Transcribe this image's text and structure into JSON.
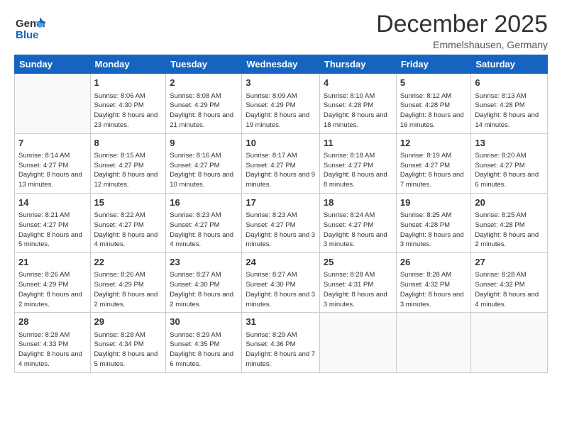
{
  "header": {
    "logo_general": "General",
    "logo_blue": "Blue",
    "month_title": "December 2025",
    "location": "Emmelshausen, Germany"
  },
  "weekdays": [
    "Sunday",
    "Monday",
    "Tuesday",
    "Wednesday",
    "Thursday",
    "Friday",
    "Saturday"
  ],
  "weeks": [
    [
      {
        "day": "",
        "sunrise": "",
        "sunset": "",
        "daylight": ""
      },
      {
        "day": "1",
        "sunrise": "Sunrise: 8:06 AM",
        "sunset": "Sunset: 4:30 PM",
        "daylight": "Daylight: 8 hours and 23 minutes."
      },
      {
        "day": "2",
        "sunrise": "Sunrise: 8:08 AM",
        "sunset": "Sunset: 4:29 PM",
        "daylight": "Daylight: 8 hours and 21 minutes."
      },
      {
        "day": "3",
        "sunrise": "Sunrise: 8:09 AM",
        "sunset": "Sunset: 4:29 PM",
        "daylight": "Daylight: 8 hours and 19 minutes."
      },
      {
        "day": "4",
        "sunrise": "Sunrise: 8:10 AM",
        "sunset": "Sunset: 4:28 PM",
        "daylight": "Daylight: 8 hours and 18 minutes."
      },
      {
        "day": "5",
        "sunrise": "Sunrise: 8:12 AM",
        "sunset": "Sunset: 4:28 PM",
        "daylight": "Daylight: 8 hours and 16 minutes."
      },
      {
        "day": "6",
        "sunrise": "Sunrise: 8:13 AM",
        "sunset": "Sunset: 4:28 PM",
        "daylight": "Daylight: 8 hours and 14 minutes."
      }
    ],
    [
      {
        "day": "7",
        "sunrise": "Sunrise: 8:14 AM",
        "sunset": "Sunset: 4:27 PM",
        "daylight": "Daylight: 8 hours and 13 minutes."
      },
      {
        "day": "8",
        "sunrise": "Sunrise: 8:15 AM",
        "sunset": "Sunset: 4:27 PM",
        "daylight": "Daylight: 8 hours and 12 minutes."
      },
      {
        "day": "9",
        "sunrise": "Sunrise: 8:16 AM",
        "sunset": "Sunset: 4:27 PM",
        "daylight": "Daylight: 8 hours and 10 minutes."
      },
      {
        "day": "10",
        "sunrise": "Sunrise: 8:17 AM",
        "sunset": "Sunset: 4:27 PM",
        "daylight": "Daylight: 8 hours and 9 minutes."
      },
      {
        "day": "11",
        "sunrise": "Sunrise: 8:18 AM",
        "sunset": "Sunset: 4:27 PM",
        "daylight": "Daylight: 8 hours and 8 minutes."
      },
      {
        "day": "12",
        "sunrise": "Sunrise: 8:19 AM",
        "sunset": "Sunset: 4:27 PM",
        "daylight": "Daylight: 8 hours and 7 minutes."
      },
      {
        "day": "13",
        "sunrise": "Sunrise: 8:20 AM",
        "sunset": "Sunset: 4:27 PM",
        "daylight": "Daylight: 8 hours and 6 minutes."
      }
    ],
    [
      {
        "day": "14",
        "sunrise": "Sunrise: 8:21 AM",
        "sunset": "Sunset: 4:27 PM",
        "daylight": "Daylight: 8 hours and 5 minutes."
      },
      {
        "day": "15",
        "sunrise": "Sunrise: 8:22 AM",
        "sunset": "Sunset: 4:27 PM",
        "daylight": "Daylight: 8 hours and 4 minutes."
      },
      {
        "day": "16",
        "sunrise": "Sunrise: 8:23 AM",
        "sunset": "Sunset: 4:27 PM",
        "daylight": "Daylight: 8 hours and 4 minutes."
      },
      {
        "day": "17",
        "sunrise": "Sunrise: 8:23 AM",
        "sunset": "Sunset: 4:27 PM",
        "daylight": "Daylight: 8 hours and 3 minutes."
      },
      {
        "day": "18",
        "sunrise": "Sunrise: 8:24 AM",
        "sunset": "Sunset: 4:27 PM",
        "daylight": "Daylight: 8 hours and 3 minutes."
      },
      {
        "day": "19",
        "sunrise": "Sunrise: 8:25 AM",
        "sunset": "Sunset: 4:28 PM",
        "daylight": "Daylight: 8 hours and 3 minutes."
      },
      {
        "day": "20",
        "sunrise": "Sunrise: 8:25 AM",
        "sunset": "Sunset: 4:28 PM",
        "daylight": "Daylight: 8 hours and 2 minutes."
      }
    ],
    [
      {
        "day": "21",
        "sunrise": "Sunrise: 8:26 AM",
        "sunset": "Sunset: 4:29 PM",
        "daylight": "Daylight: 8 hours and 2 minutes."
      },
      {
        "day": "22",
        "sunrise": "Sunrise: 8:26 AM",
        "sunset": "Sunset: 4:29 PM",
        "daylight": "Daylight: 8 hours and 2 minutes."
      },
      {
        "day": "23",
        "sunrise": "Sunrise: 8:27 AM",
        "sunset": "Sunset: 4:30 PM",
        "daylight": "Daylight: 8 hours and 2 minutes."
      },
      {
        "day": "24",
        "sunrise": "Sunrise: 8:27 AM",
        "sunset": "Sunset: 4:30 PM",
        "daylight": "Daylight: 8 hours and 3 minutes."
      },
      {
        "day": "25",
        "sunrise": "Sunrise: 8:28 AM",
        "sunset": "Sunset: 4:31 PM",
        "daylight": "Daylight: 8 hours and 3 minutes."
      },
      {
        "day": "26",
        "sunrise": "Sunrise: 8:28 AM",
        "sunset": "Sunset: 4:32 PM",
        "daylight": "Daylight: 8 hours and 3 minutes."
      },
      {
        "day": "27",
        "sunrise": "Sunrise: 8:28 AM",
        "sunset": "Sunset: 4:32 PM",
        "daylight": "Daylight: 8 hours and 4 minutes."
      }
    ],
    [
      {
        "day": "28",
        "sunrise": "Sunrise: 8:28 AM",
        "sunset": "Sunset: 4:33 PM",
        "daylight": "Daylight: 8 hours and 4 minutes."
      },
      {
        "day": "29",
        "sunrise": "Sunrise: 8:28 AM",
        "sunset": "Sunset: 4:34 PM",
        "daylight": "Daylight: 8 hours and 5 minutes."
      },
      {
        "day": "30",
        "sunrise": "Sunrise: 8:29 AM",
        "sunset": "Sunset: 4:35 PM",
        "daylight": "Daylight: 8 hours and 6 minutes."
      },
      {
        "day": "31",
        "sunrise": "Sunrise: 8:29 AM",
        "sunset": "Sunset: 4:36 PM",
        "daylight": "Daylight: 8 hours and 7 minutes."
      },
      {
        "day": "",
        "sunrise": "",
        "sunset": "",
        "daylight": ""
      },
      {
        "day": "",
        "sunrise": "",
        "sunset": "",
        "daylight": ""
      },
      {
        "day": "",
        "sunrise": "",
        "sunset": "",
        "daylight": ""
      }
    ]
  ]
}
